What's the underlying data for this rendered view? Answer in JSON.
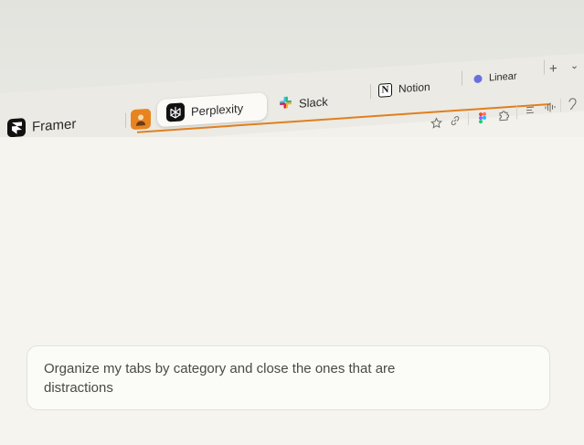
{
  "tabs": [
    {
      "label": "Framer",
      "icon": "framer-icon"
    },
    {
      "label": "",
      "icon": "avatar-tab-icon"
    },
    {
      "label": "Perplexity",
      "icon": "perplexity-icon",
      "active": true
    },
    {
      "label": "Slack",
      "icon": "slack-icon"
    },
    {
      "label": "Notion",
      "icon": "notion-icon"
    },
    {
      "label": "Linear",
      "icon": "linear-icon"
    }
  ],
  "tabstrip_controls": {
    "new_tab": "+",
    "tab_menu": "⌄"
  },
  "toolbar_icons": [
    "star-icon",
    "link-icon",
    "figma-icon",
    "extension-icon",
    "list-icon",
    "audio-icon",
    "ear-icon"
  ],
  "prompt": {
    "text": "Organize my tabs by category and close the ones that are distractions"
  },
  "colors": {
    "framer_group": "#2d7fa8",
    "perplexity_group": "#e07f1f",
    "accent_avatar": "#e8841f"
  }
}
